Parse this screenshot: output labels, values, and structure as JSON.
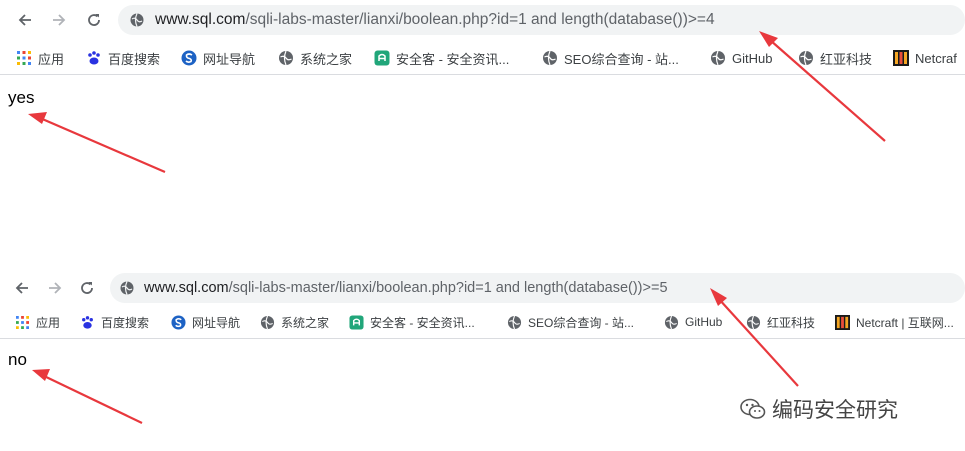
{
  "top": {
    "url_host": "www.sql.com",
    "url_path": "/sqli-labs-master/lianxi/boolean.php?id=1 and length(database())>=4",
    "result": "yes"
  },
  "bottom": {
    "url_host": "www.sql.com",
    "url_path": "/sqli-labs-master/lianxi/boolean.php?id=1 and length(database())>=5",
    "result": "no"
  },
  "bookmarks_top": [
    {
      "label": "应用",
      "icon": "apps-grid-icon"
    },
    {
      "label": "百度搜索",
      "icon": "baidu-paw-icon"
    },
    {
      "label": "网址导航",
      "icon": "sogou-icon"
    },
    {
      "label": "系统之家",
      "icon": "globe-icon"
    },
    {
      "label": "安全客 - 安全资讯...",
      "icon": "anquanke-icon"
    },
    {
      "label": "SEO综合查询 - 站...",
      "icon": "globe-icon"
    },
    {
      "label": "GitHub",
      "icon": "globe-icon"
    },
    {
      "label": "红亚科技",
      "icon": "globe-icon"
    },
    {
      "label": "Netcraf",
      "icon": "netcraft-icon"
    }
  ],
  "bookmarks_bottom": [
    {
      "label": "应用",
      "icon": "apps-grid-icon"
    },
    {
      "label": "百度搜索",
      "icon": "baidu-paw-icon"
    },
    {
      "label": "网址导航",
      "icon": "sogou-icon"
    },
    {
      "label": "系统之家",
      "icon": "globe-icon"
    },
    {
      "label": "安全客 - 安全资讯...",
      "icon": "anquanke-icon"
    },
    {
      "label": "SEO综合查询 - 站...",
      "icon": "globe-icon"
    },
    {
      "label": "GitHub",
      "icon": "globe-icon"
    },
    {
      "label": "红亚科技",
      "icon": "globe-icon"
    },
    {
      "label": "Netcraft | 互联网...",
      "icon": "netcraft-icon"
    }
  ],
  "watermark": "编码安全研究",
  "colors": {
    "arrow": "#e8383d",
    "omnibox": "#f1f3f4",
    "text": "#202124"
  }
}
